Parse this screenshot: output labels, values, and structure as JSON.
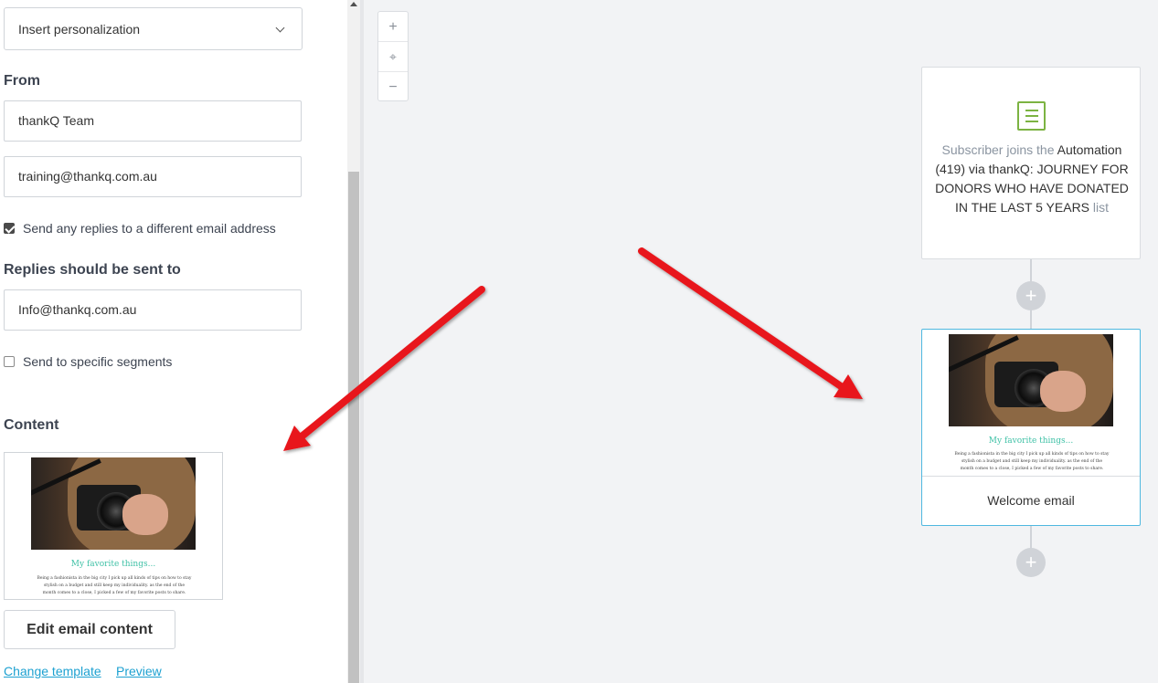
{
  "left_panel": {
    "personalization_select": {
      "label": "Insert personalization",
      "icon": "chevron-down-icon"
    },
    "from_heading": "From",
    "from_name": "thankQ Team",
    "from_email": "training@thankq.com.au",
    "reply_checkbox": {
      "label": "Send any replies to a different email address",
      "checked": true
    },
    "replies_heading": "Replies should be sent to",
    "reply_email": "Info@thankq.com.au",
    "segments_checkbox": {
      "label": "Send to specific segments",
      "checked": false
    },
    "content_heading": "Content",
    "thumbnail": {
      "headline": "My favorite things...",
      "body_line1": "Being a fashionista in the big city I pick up all kinds of tips on how to stay",
      "body_line2": "stylish on a budget and still keep my individuality. as the end of the",
      "body_line3": "month comes to a close, I picked a few of my favorite posts to share."
    },
    "edit_button": "Edit email content",
    "change_template_link": "Change template",
    "preview_link": "Preview"
  },
  "canvas": {
    "zoom": {
      "zoom_in": "+",
      "center": "⌖",
      "zoom_out": "−"
    },
    "trigger_card": {
      "icon": "list-icon",
      "text_prefix": "Subscriber joins the",
      "text_main": "Automation (419) via thankQ: JOURNEY FOR DONORS WHO HAVE DONATED IN THE LAST 5 YEARS",
      "text_suffix": "list"
    },
    "add_step_label": "+",
    "email_card": {
      "headline": "My favorite things...",
      "body_line1": "Being a fashionista in the big city I pick up all kinds of tips on how to stay",
      "body_line2": "stylish on a budget and still keep my individuality. as the end of the",
      "body_line3": "month comes to a close, I picked a few of my favorite posts to share.",
      "title": "Welcome email"
    }
  },
  "colors": {
    "link": "#1da1d1",
    "accent_border": "#4fb8e0",
    "list_icon": "#7cb342",
    "headline_teal": "#3fc1a6",
    "annotation_arrow": "#e8151a"
  }
}
